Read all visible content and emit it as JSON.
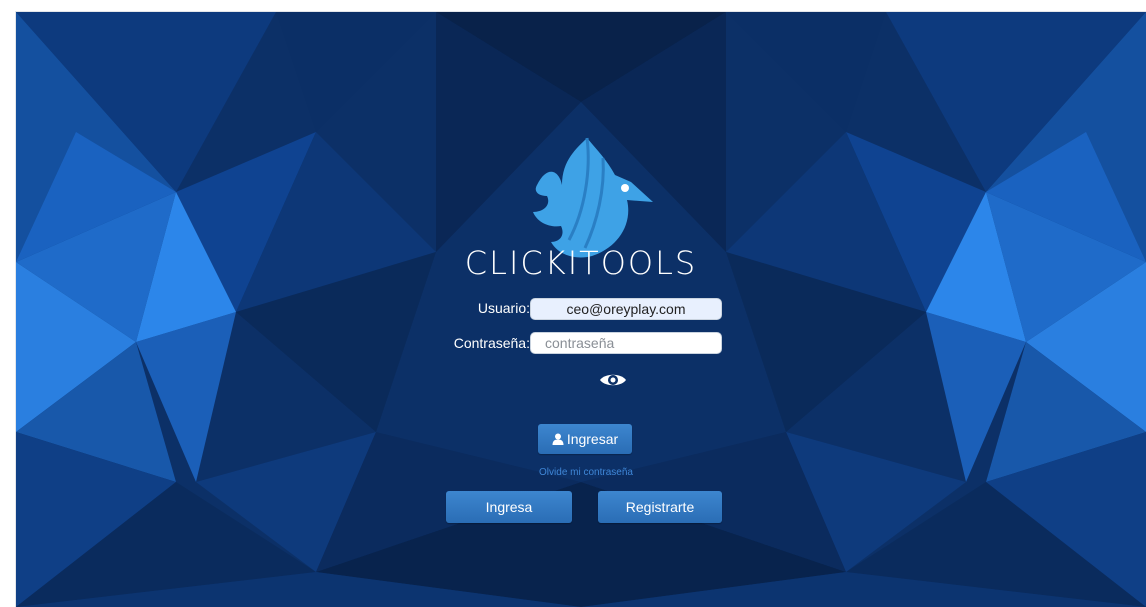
{
  "brand": {
    "name": "CLICKITOOLS",
    "logo_icon": "bird-icon"
  },
  "login": {
    "user_label": "Usuario:",
    "user_value": "ceo@oreyplay.com",
    "password_label": "Contraseña:",
    "password_placeholder": "contraseña",
    "toggle_icon": "eye-icon",
    "submit_icon": "user-icon",
    "submit_label": "Ingresar",
    "forgot_link": "Olvide mi contraseña"
  },
  "footer_actions": {
    "signin_label": "Ingresa",
    "register_label": "Registrarte"
  },
  "colors": {
    "background": "#0b2f63",
    "accent": "#3a8fe0",
    "button": "#2f78c3",
    "logo": "#3ea2e6"
  }
}
